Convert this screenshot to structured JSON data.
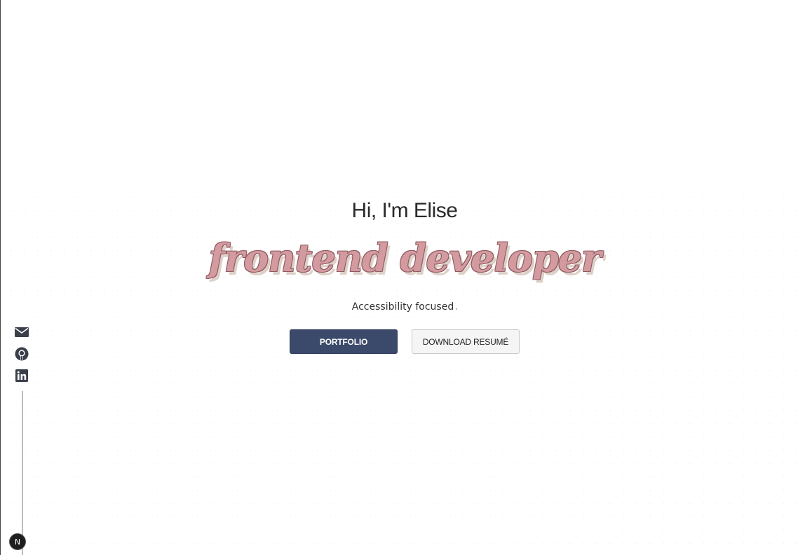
{
  "hero": {
    "greeting": "Hi, I'm Elise",
    "role": "frontend developer",
    "tagline": "Accessibility focused"
  },
  "buttons": {
    "primary_label": "PORTFOLIO",
    "secondary_label": "DOWNLOAD RESUMÉ"
  },
  "social": {
    "icons": [
      "mail-icon",
      "github-icon",
      "linkedin-icon"
    ]
  },
  "badge": {
    "letter": "N"
  },
  "colors": {
    "primary_button": "#3b4a6b",
    "role_text": "#d39ba0",
    "background": "#ffffff"
  }
}
